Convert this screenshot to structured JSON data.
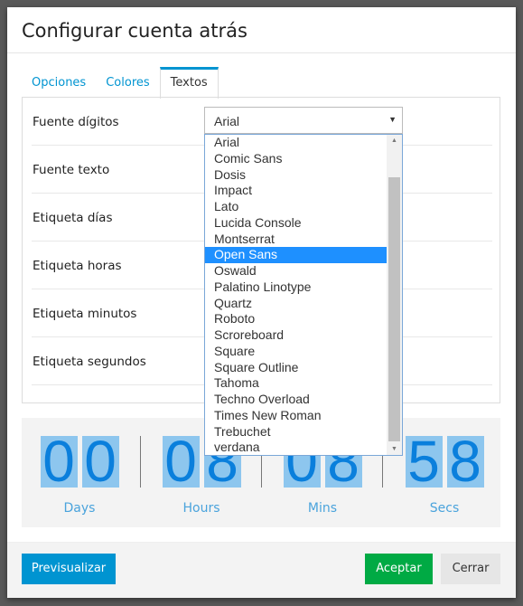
{
  "dialog": {
    "title": "Configurar cuenta atrás"
  },
  "tabs": [
    {
      "label": "Opciones"
    },
    {
      "label": "Colores"
    },
    {
      "label": "Textos",
      "active": true
    }
  ],
  "fields": [
    {
      "label": "Fuente dígitos"
    },
    {
      "label": "Fuente texto"
    },
    {
      "label": "Etiqueta días"
    },
    {
      "label": "Etiqueta horas"
    },
    {
      "label": "Etiqueta minutos"
    },
    {
      "label": "Etiqueta segundos"
    }
  ],
  "font_select": {
    "value": "Arial",
    "highlighted": "Open Sans",
    "options": [
      "Arial",
      "Comic Sans",
      "Dosis",
      "Impact",
      "Lato",
      "Lucida Console",
      "Montserrat",
      "Open Sans",
      "Oswald",
      "Palatino Linotype",
      "Quartz",
      "Roboto",
      "Scroreboard",
      "Square",
      "Square Outline",
      "Tahoma",
      "Techno Overload",
      "Times New Roman",
      "Trebuchet",
      "verdana"
    ]
  },
  "countdown": [
    {
      "digits": [
        "0",
        "0"
      ],
      "label": "Days"
    },
    {
      "digits": [
        "0",
        "8"
      ],
      "label": "Hours"
    },
    {
      "digits": [
        "0",
        "8"
      ],
      "label": "Mins"
    },
    {
      "digits": [
        "5",
        "8"
      ],
      "label": "Secs"
    }
  ],
  "footer": {
    "preview": "Previsualizar",
    "accept": "Aceptar",
    "close": "Cerrar"
  },
  "colors": {
    "accent": "#0094d1",
    "accept": "#00aa44",
    "digit_bg": "#8dc6ee",
    "digit_fg": "#0a7fdc"
  }
}
